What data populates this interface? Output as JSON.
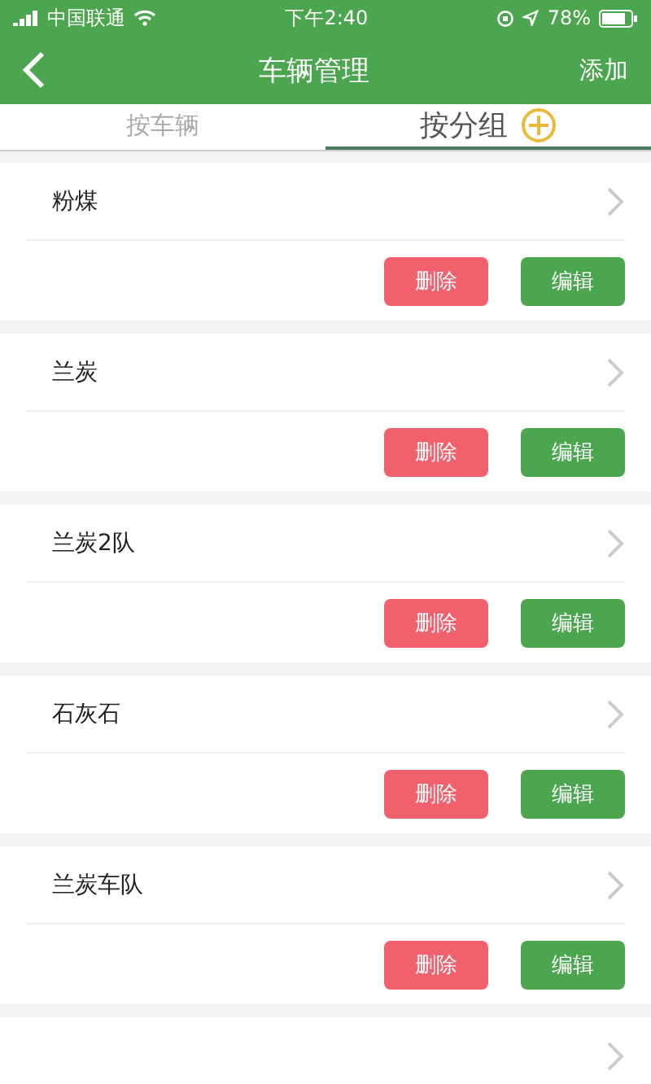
{
  "status_bar": {
    "carrier": "中国联通",
    "time": "下午2:40",
    "battery": "78%"
  },
  "nav": {
    "title": "车辆管理",
    "action": "添加"
  },
  "tabs": [
    {
      "label": "按车辆",
      "selected": false
    },
    {
      "label": "按分组",
      "selected": true
    }
  ],
  "groups": [
    {
      "name": "粉煤",
      "delete": "删除",
      "edit": "编辑"
    },
    {
      "name": "兰炭",
      "delete": "删除",
      "edit": "编辑"
    },
    {
      "name": "兰炭2队",
      "delete": "删除",
      "edit": "编辑"
    },
    {
      "name": "石灰石",
      "delete": "删除",
      "edit": "编辑"
    },
    {
      "name": "兰炭车队",
      "delete": "删除",
      "edit": "编辑"
    }
  ]
}
